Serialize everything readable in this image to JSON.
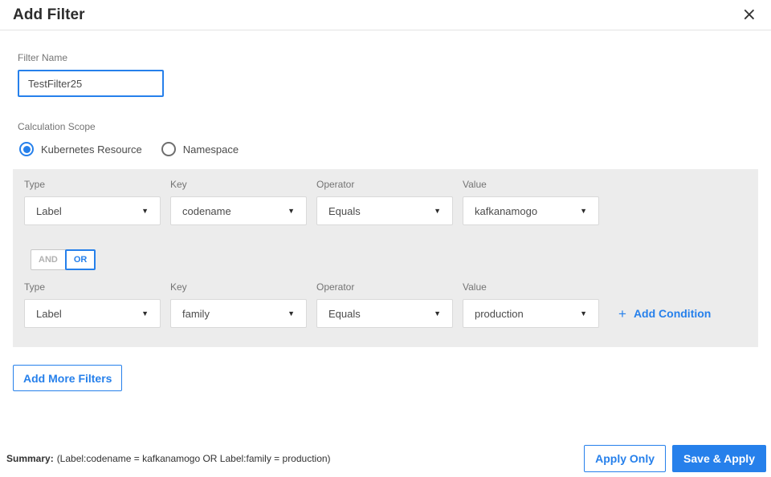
{
  "dialog": {
    "title": "Add Filter",
    "close_icon": "×"
  },
  "filter_name": {
    "label": "Filter Name",
    "value": "TestFilter25"
  },
  "calculation_scope": {
    "label": "Calculation Scope",
    "options": [
      {
        "label": "Kubernetes Resource",
        "selected": true
      },
      {
        "label": "Namespace",
        "selected": false
      }
    ]
  },
  "conditions": {
    "column_labels": {
      "type": "Type",
      "key": "Key",
      "operator": "Operator",
      "value": "Value"
    },
    "rows": [
      {
        "type": "Label",
        "key": "codename",
        "operator": "Equals",
        "value": "kafkanamogo"
      },
      {
        "type": "Label",
        "key": "family",
        "operator": "Equals",
        "value": "production"
      }
    ],
    "logic_toggle": {
      "and_label": "AND",
      "or_label": "OR",
      "selected": "OR"
    },
    "add_condition": {
      "plus_icon": "+",
      "label": "Add Condition"
    }
  },
  "add_more_filters_label": "Add More Filters",
  "footer": {
    "summary_label": "Summary:",
    "summary_text": "(Label:codename = kafkanamogo OR Label:family = production)",
    "apply_only_label": "Apply Only",
    "save_apply_label": "Save & Apply"
  },
  "colors": {
    "accent_blue": "#2680eb",
    "panel_gray": "#ececec"
  },
  "icons": {
    "dropdown_caret": "▼"
  }
}
